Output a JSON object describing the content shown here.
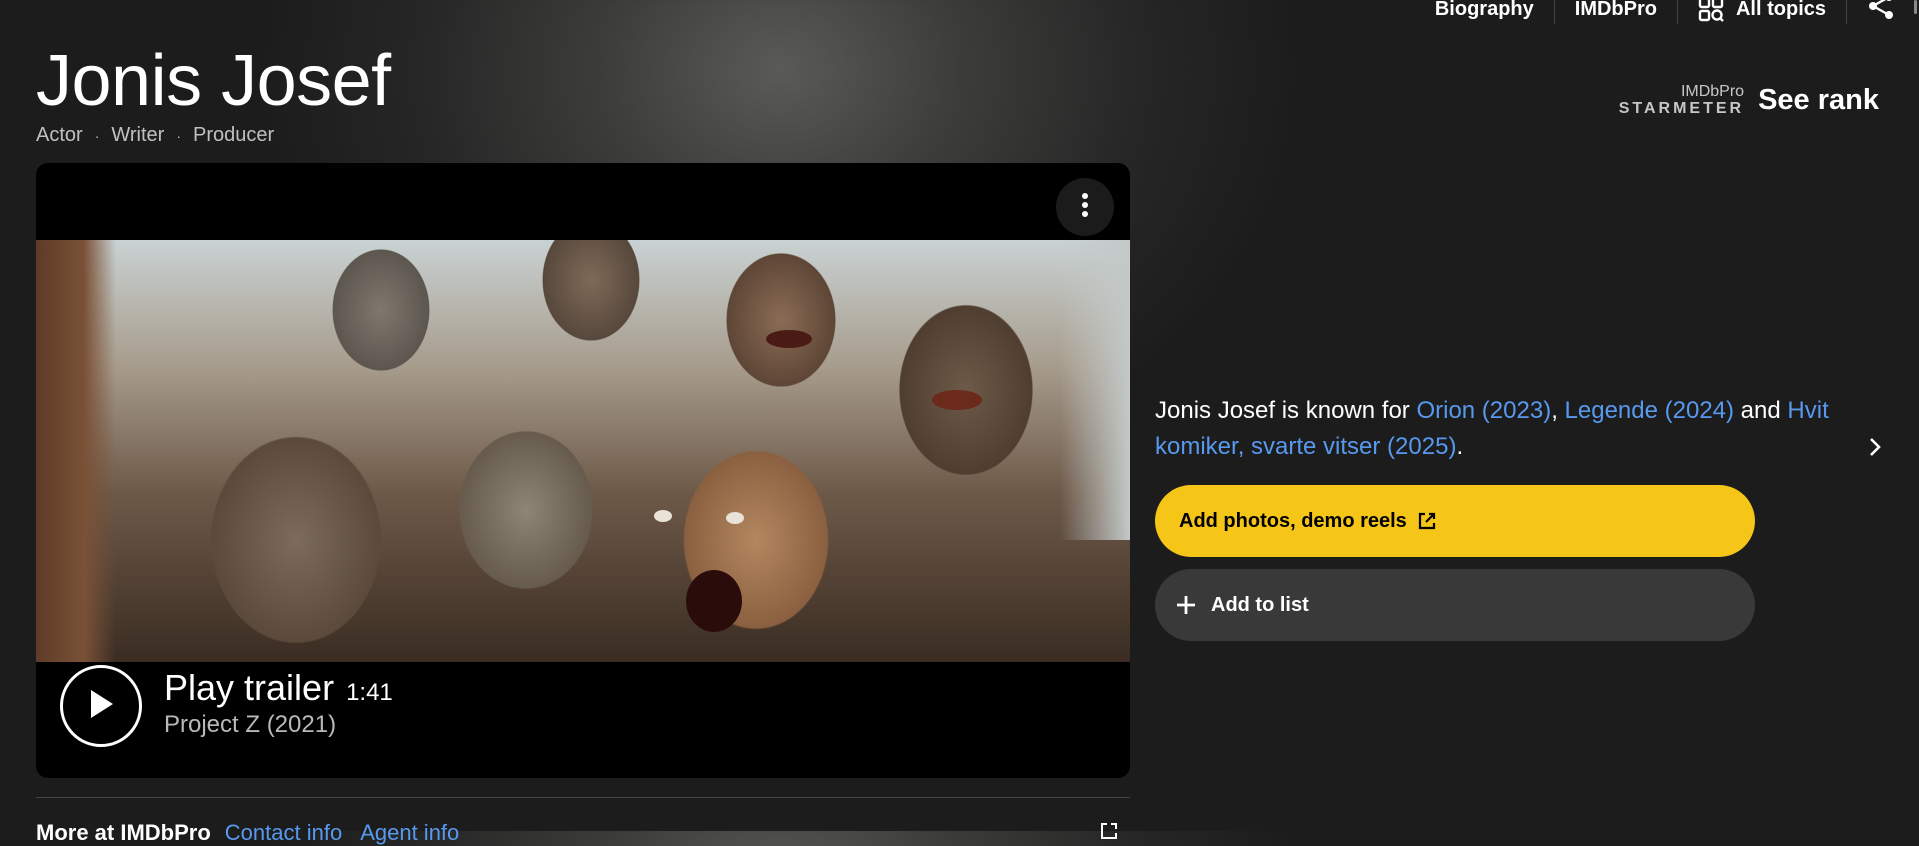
{
  "nav": {
    "items": [
      {
        "label": "Biography"
      },
      {
        "label": "IMDbPro"
      },
      {
        "label": "All topics",
        "icon": "all-topics-icon"
      },
      {
        "label": "",
        "icon": "share-icon"
      }
    ]
  },
  "person": {
    "name": "Jonis Josef",
    "roles": [
      "Actor",
      "Writer",
      "Producer"
    ],
    "role_separator": "·"
  },
  "starmeter": {
    "brand": "IMDbPro",
    "label": "STARMETER",
    "action": "See rank"
  },
  "video": {
    "play_label": "Play trailer",
    "duration": "1:41",
    "title": "Project Z (2021)",
    "menu_icon": "more-vert-icon",
    "play_icon": "play-icon"
  },
  "known_for": {
    "prefix": "Jonis Josef is known for ",
    "titles": [
      "Orion (2023)",
      "Legende (2024)",
      "Hvit komiker, svarte vitser (2025)"
    ],
    "sep1": ", ",
    "sep2": " and ",
    "suffix": "."
  },
  "actions": {
    "add_media": "Add photos, demo reels",
    "add_to_list": "Add to list"
  },
  "bottom": {
    "heading": "More at IMDbPro",
    "links": [
      "Contact info",
      "Agent info"
    ]
  },
  "colors": {
    "accent_yellow": "#f5c518",
    "link_blue": "#5799ef",
    "background": "#1f1f1f"
  }
}
